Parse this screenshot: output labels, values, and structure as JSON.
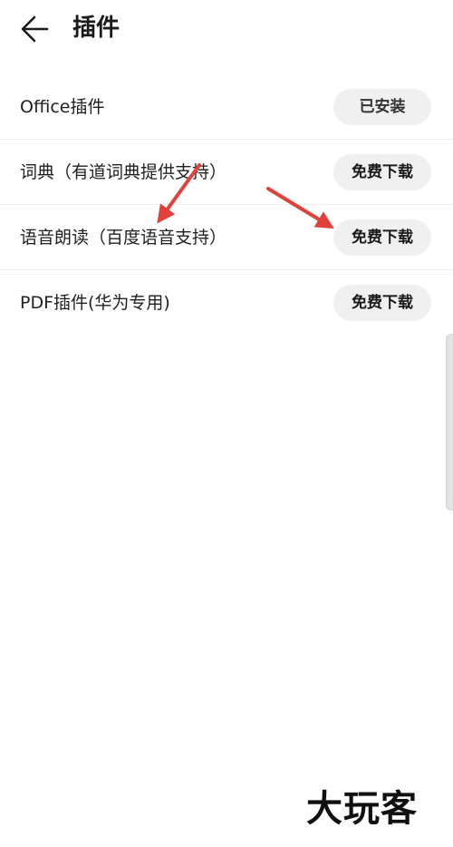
{
  "header": {
    "title": "插件",
    "back_icon": "arrow-left-icon"
  },
  "plugins": [
    {
      "label": "Office插件",
      "button": "已安装",
      "status": "installed"
    },
    {
      "label": "词典（有道词典提供支持）",
      "button": "免费下载",
      "status": "available"
    },
    {
      "label": "语音朗读（百度语音支持）",
      "button": "免费下载",
      "status": "available"
    },
    {
      "label": "PDF插件(华为专用)",
      "button": "免费下载",
      "status": "available"
    }
  ],
  "watermark": "大玩客",
  "colors": {
    "background": "#ffffff",
    "button_bg": "#f0f0f0",
    "divider": "#eeeeee",
    "annotation_arrow": "#e0413a"
  }
}
